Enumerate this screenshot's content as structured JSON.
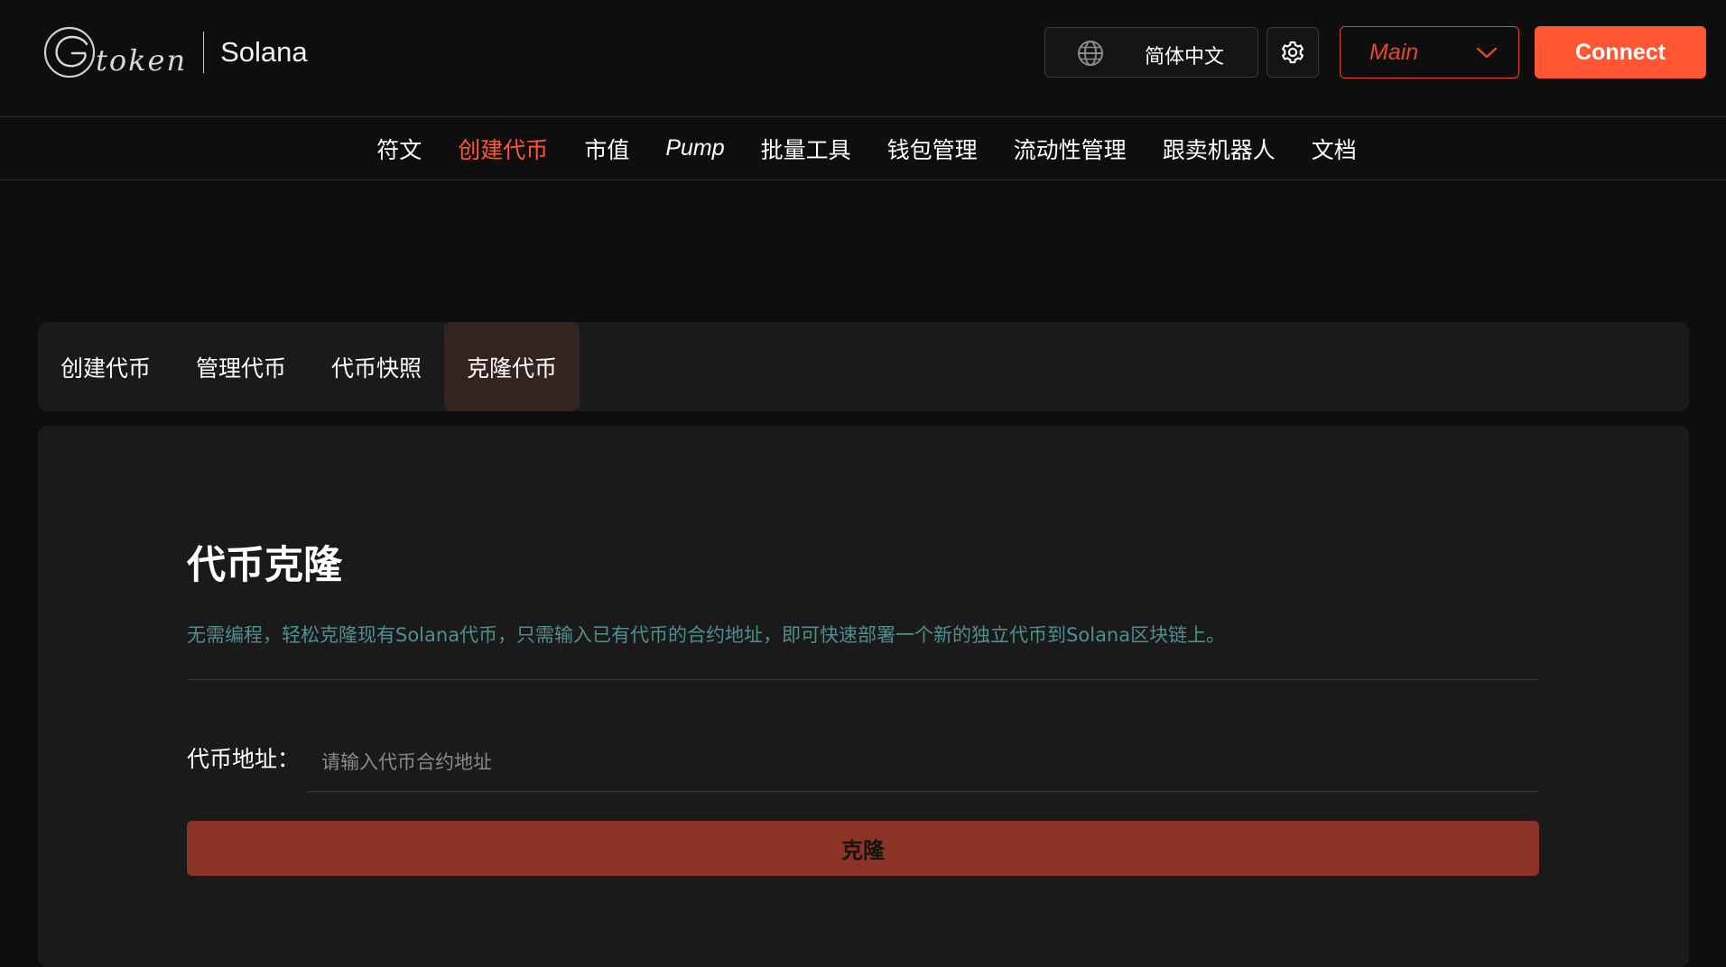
{
  "header": {
    "logo_word": "token",
    "chain_name": "Solana",
    "language_label": "简体中文",
    "network_label": "Main",
    "connect_label": "Connect"
  },
  "nav": {
    "items": [
      {
        "label": "符文"
      },
      {
        "label": "创建代币",
        "active": true
      },
      {
        "label": "市值"
      },
      {
        "label": "Pump"
      },
      {
        "label": "批量工具"
      },
      {
        "label": "钱包管理"
      },
      {
        "label": "流动性管理"
      },
      {
        "label": "跟卖机器人"
      },
      {
        "label": "文档"
      }
    ]
  },
  "tabs": {
    "items": [
      {
        "label": "创建代币"
      },
      {
        "label": "管理代币"
      },
      {
        "label": "代币快照"
      },
      {
        "label": "克隆代币",
        "active": true
      }
    ]
  },
  "card": {
    "title": "代币克隆",
    "description": "无需编程，轻松克隆现有Solana代币，只需输入已有代币的合约地址，即可快速部署一个新的独立代币到Solana区块链上。",
    "address_label": "代币地址：",
    "address_value": "",
    "address_placeholder": "请输入代币合约地址",
    "clone_label": "克隆"
  },
  "colors": {
    "accent": "#ff5733",
    "active_tab_bg": "#352320",
    "clone_button": "#8b3426",
    "description_text": "#4f8f8c",
    "page_bg": "#0e0e0f",
    "panel_bg": "#1a1a1b"
  },
  "icons": {
    "logo": "g-token-logo-icon",
    "language": "globe-icon",
    "settings": "gear-icon",
    "network_dropdown": "chevron-down-icon"
  }
}
